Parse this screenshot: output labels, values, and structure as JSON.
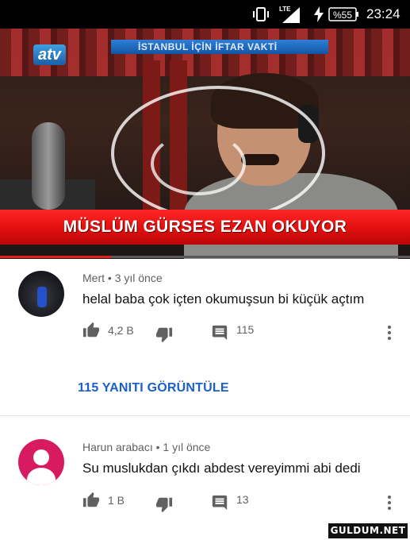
{
  "status_bar": {
    "network": "LTE",
    "battery": "%55",
    "time": "23:24"
  },
  "video": {
    "channel_logo": "atv",
    "top_caption": "İSTANBUL İÇİN İFTAR VAKTİ",
    "banner_caption": "MÜSLÜM GÜRSES EZAN OKUYOR",
    "progress": 0.27
  },
  "comments": [
    {
      "author": "Mert",
      "time": "3 yıl önce",
      "text": "helal baba çok içten okumuşsun bi küçük açtım",
      "likes": "4,2 B",
      "reply_count": "115"
    },
    {
      "author": "Harun arabacı",
      "time": "1 yıl önce",
      "text": "Su muslukdan çıkdı abdest vereyimmi abi dedi",
      "likes": "1 B",
      "reply_count": "13"
    }
  ],
  "view_replies_label": "115 YANITI GÖRÜNTÜLE",
  "meta_separator": "•",
  "watermark": "GULDUM.NET",
  "colors": {
    "link": "#1a60c9",
    "banner_red": "#e10f0f",
    "default_avatar": "#d81b60"
  },
  "icons": {
    "like": "thumb-up-icon",
    "dislike": "thumb-down-icon",
    "reply": "comment-icon",
    "more": "more-vert-icon"
  }
}
